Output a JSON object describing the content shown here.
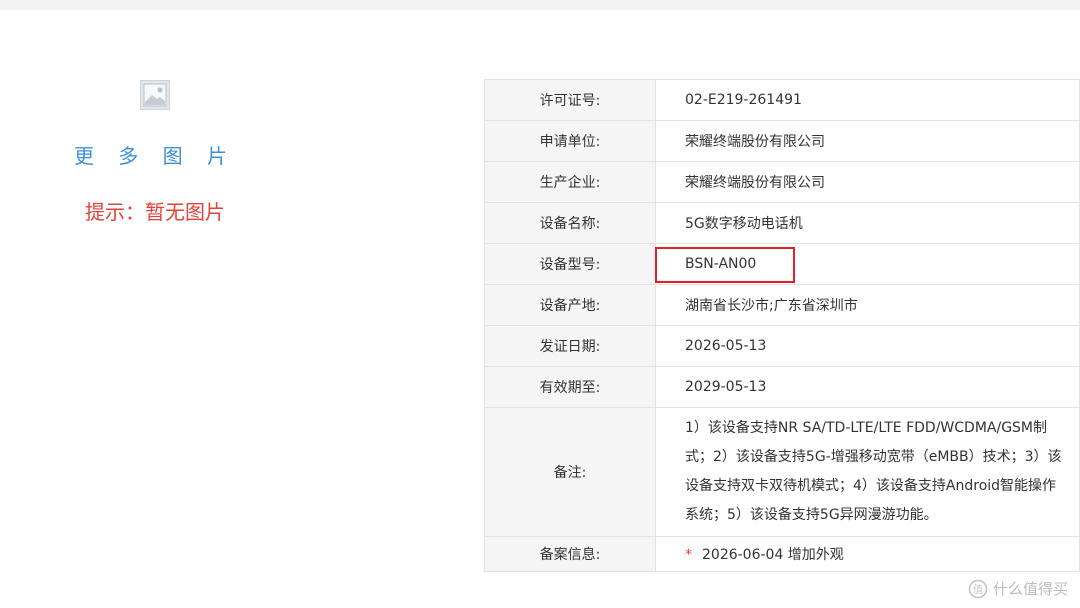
{
  "gallery": {
    "more_images_label": "更 多 图 片",
    "hint": "提示：暂无图片"
  },
  "details": {
    "rows": [
      {
        "label": "许可证号:",
        "value": "02-E219-261491"
      },
      {
        "label": "申请单位:",
        "value": "荣耀终端股份有限公司"
      },
      {
        "label": "生产企业:",
        "value": "荣耀终端股份有限公司"
      },
      {
        "label": "设备名称:",
        "value": "5G数字移动电话机"
      },
      {
        "label": "设备型号:",
        "value": "BSN-AN00"
      },
      {
        "label": "设备产地:",
        "value": "湖南省长沙市;广东省深圳市"
      },
      {
        "label": "发证日期:",
        "value": "2026-05-13"
      },
      {
        "label": "有效期至:",
        "value": "2029-05-13"
      }
    ],
    "remark": {
      "label": "备注:",
      "value": "1）该设备支持NR SA/TD-LTE/LTE FDD/WCDMA/GSM制式；2）该设备支持5G-增强移动宽带（eMBB）技术；3）该设备支持双卡双待机模式；4）该设备支持Android智能操作系统；5）该设备支持5G异网漫游功能。"
    },
    "record": {
      "label": "备案信息:",
      "star": "*",
      "value": "2026-06-04 增加外观"
    }
  },
  "watermark": {
    "text": "什么值得买"
  },
  "colors": {
    "link": "#3e8fd6",
    "hint": "#e0433b",
    "highlight_border": "#e0212a",
    "label_bg": "#f5f5f5",
    "border": "#e3e3e3"
  }
}
